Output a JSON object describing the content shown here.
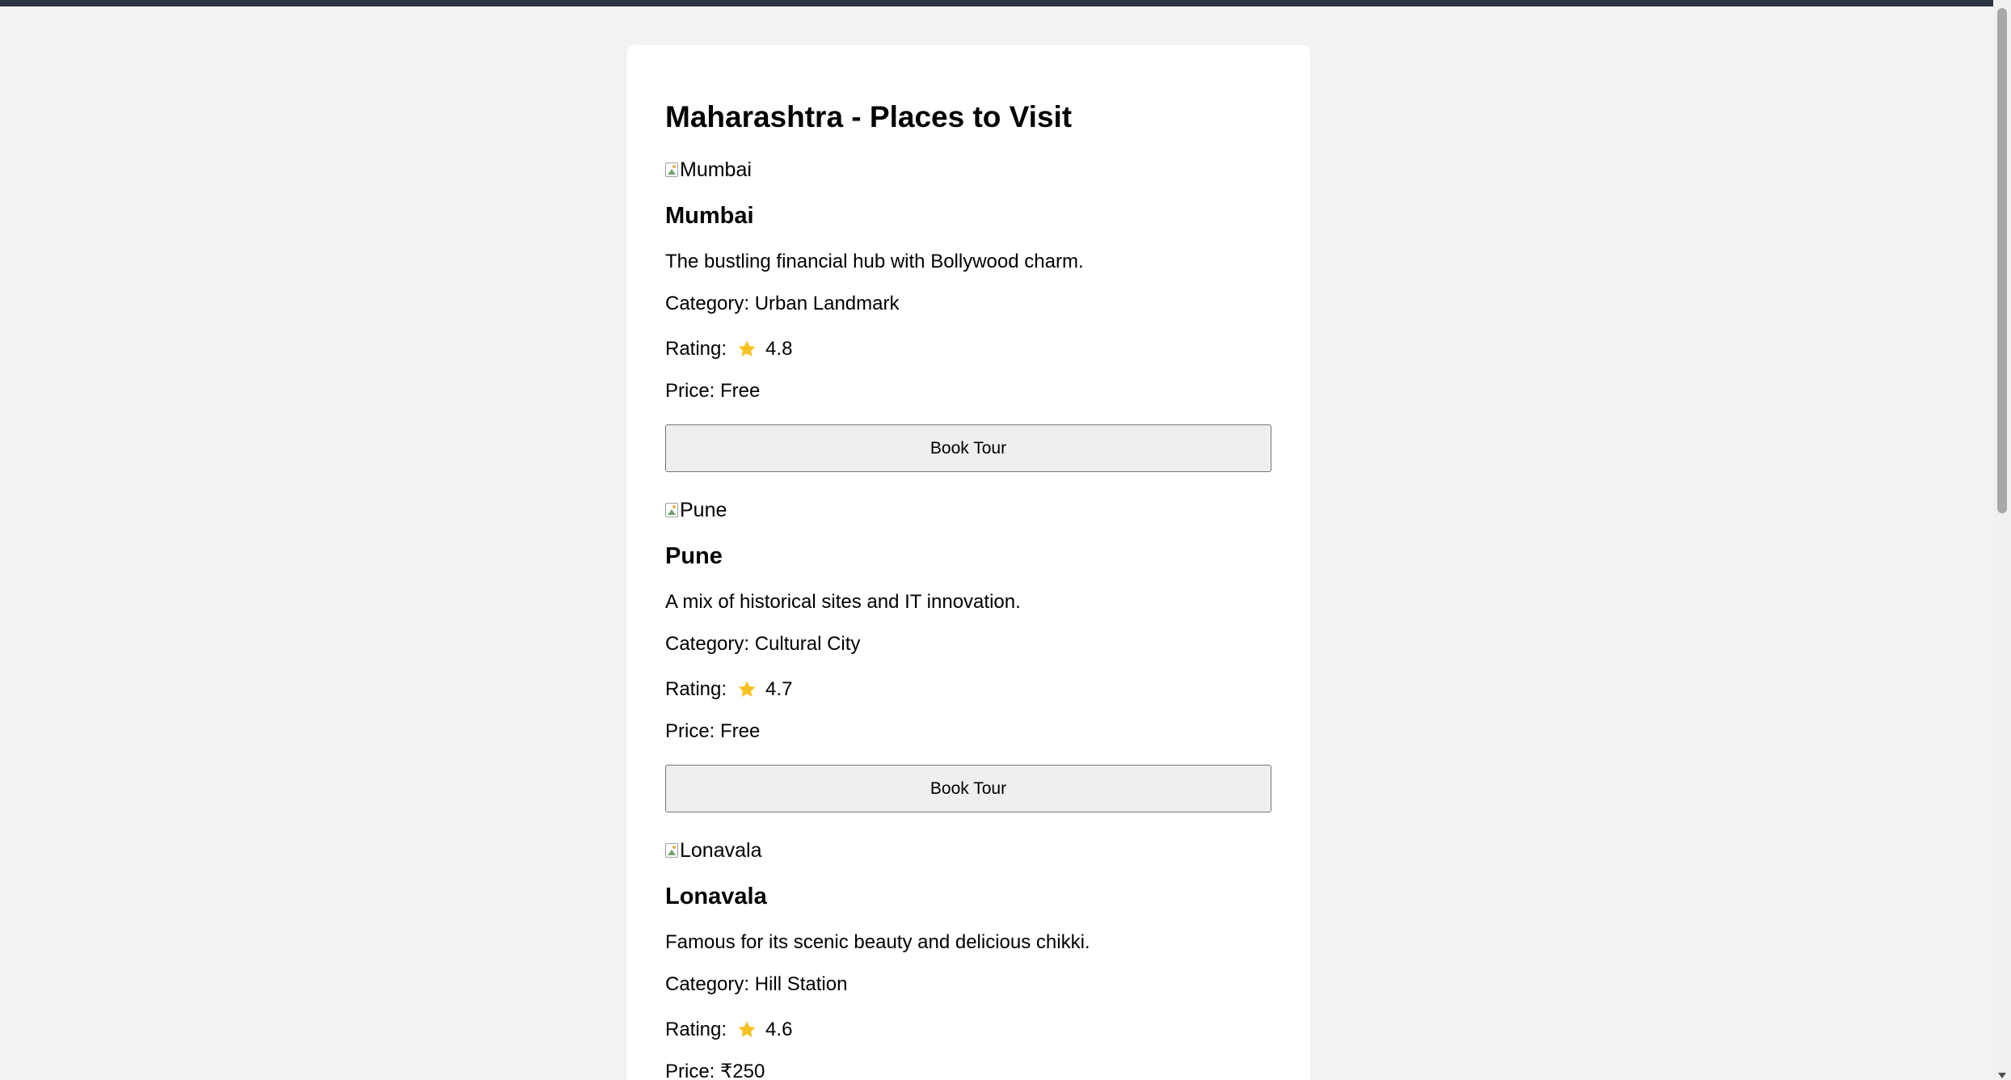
{
  "page": {
    "title": "Maharashtra - Places to Visit",
    "rating_prefix": "Rating:",
    "book_label": "Book Tour",
    "accent_star_color": "#f7c21f",
    "button_bg": "#efefef",
    "background": "#f3f3f3"
  },
  "places": [
    {
      "img_alt": "Mumbai",
      "name": "Mumbai",
      "description": "The bustling financial hub with Bollywood charm.",
      "category": "Category: Urban Landmark",
      "rating": "4.8",
      "price": "Price: Free"
    },
    {
      "img_alt": "Pune",
      "name": "Pune",
      "description": "A mix of historical sites and IT innovation.",
      "category": "Category: Cultural City",
      "rating": "4.7",
      "price": "Price: Free"
    },
    {
      "img_alt": "Lonavala",
      "name": "Lonavala",
      "description": "Famous for its scenic beauty and delicious chikki.",
      "category": "Category: Hill Station",
      "rating": "4.6",
      "price": "Price: ₹250"
    }
  ]
}
